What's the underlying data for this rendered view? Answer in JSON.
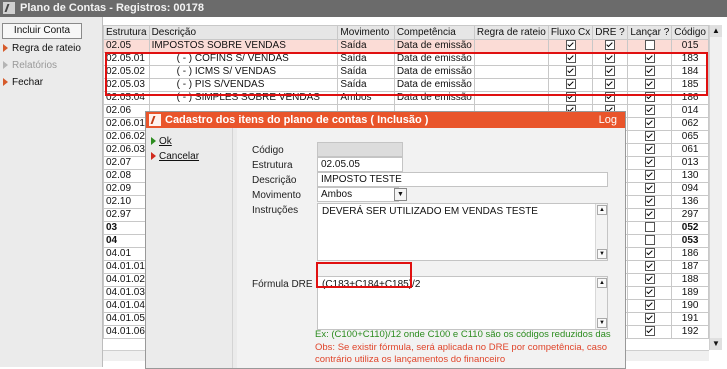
{
  "window": {
    "title": "Plano de Contas - Registros: 00178"
  },
  "sidebar": {
    "include_button": "Incluir Conta",
    "items": [
      {
        "label": "Regra de rateio",
        "enabled": true
      },
      {
        "label": "Relatórios",
        "enabled": false
      },
      {
        "label": "Fechar",
        "enabled": true
      }
    ]
  },
  "grid": {
    "columns": [
      "Estrutura",
      "Descrição",
      "Movimento",
      "Competência",
      "Regra de rateio",
      "Fluxo Cx",
      "DRE ?",
      "Lançar ?",
      "Código"
    ],
    "rows": [
      {
        "estrutura": "02.05",
        "descricao": "IMPOSTOS SOBRE VENDAS",
        "movimento": "Saída",
        "competencia": "Data de emissão",
        "regra": "",
        "fluxo": true,
        "dre": true,
        "lancar": false,
        "codigo": "015",
        "highlight": true,
        "bold": false
      },
      {
        "estrutura": "02.05.01",
        "descricao": "         ( - ) COFINS S/ VENDAS",
        "movimento": "Saída",
        "competencia": "Data de emissão",
        "regra": "",
        "fluxo": true,
        "dre": true,
        "lancar": true,
        "codigo": "183",
        "highlight": false,
        "bold": false
      },
      {
        "estrutura": "02.05.02",
        "descricao": "         ( - ) ICMS S/ VENDAS",
        "movimento": "Saída",
        "competencia": "Data de emissão",
        "regra": "",
        "fluxo": true,
        "dre": true,
        "lancar": true,
        "codigo": "184",
        "highlight": false,
        "bold": false
      },
      {
        "estrutura": "02.05.03",
        "descricao": "         ( - ) PIS S/VENDAS",
        "movimento": "Saída",
        "competencia": "Data de emissão",
        "regra": "",
        "fluxo": true,
        "dre": true,
        "lancar": true,
        "codigo": "185",
        "highlight": false,
        "bold": false
      },
      {
        "estrutura": "02.05.04",
        "descricao": "         ( - ) SIMPLES SOBRE VENDAS",
        "movimento": "Ambos",
        "competencia": "Data de emissão",
        "regra": "",
        "fluxo": true,
        "dre": true,
        "lancar": true,
        "codigo": "186",
        "highlight": false,
        "bold": false
      },
      {
        "estrutura": "02.06",
        "descricao": "",
        "movimento": "",
        "competencia": "",
        "regra": "",
        "fluxo": true,
        "dre": true,
        "lancar": true,
        "codigo": "014",
        "highlight": false,
        "bold": false
      },
      {
        "estrutura": "02.06.01",
        "descricao": "",
        "movimento": "",
        "competencia": "",
        "regra": "",
        "fluxo": true,
        "dre": true,
        "lancar": true,
        "codigo": "062",
        "highlight": false,
        "bold": false
      },
      {
        "estrutura": "02.06.02",
        "descricao": "",
        "movimento": "",
        "competencia": "",
        "regra": "",
        "fluxo": true,
        "dre": true,
        "lancar": true,
        "codigo": "065",
        "highlight": false,
        "bold": false
      },
      {
        "estrutura": "02.06.03",
        "descricao": "",
        "movimento": "",
        "competencia": "",
        "regra": "",
        "fluxo": true,
        "dre": true,
        "lancar": true,
        "codigo": "061",
        "highlight": false,
        "bold": false
      },
      {
        "estrutura": "02.07",
        "descricao": "",
        "movimento": "",
        "competencia": "",
        "regra": "",
        "fluxo": true,
        "dre": true,
        "lancar": true,
        "codigo": "013",
        "highlight": false,
        "bold": false
      },
      {
        "estrutura": "02.08",
        "descricao": "",
        "movimento": "",
        "competencia": "",
        "regra": "",
        "fluxo": true,
        "dre": true,
        "lancar": true,
        "codigo": "130",
        "highlight": false,
        "bold": false
      },
      {
        "estrutura": "02.09",
        "descricao": "",
        "movimento": "",
        "competencia": "",
        "regra": "",
        "fluxo": true,
        "dre": true,
        "lancar": true,
        "codigo": "094",
        "highlight": false,
        "bold": false
      },
      {
        "estrutura": "02.10",
        "descricao": "",
        "movimento": "",
        "competencia": "",
        "regra": "",
        "fluxo": true,
        "dre": true,
        "lancar": true,
        "codigo": "136",
        "highlight": false,
        "bold": false
      },
      {
        "estrutura": "02.97",
        "descricao": "",
        "movimento": "",
        "competencia": "",
        "regra": "",
        "fluxo": true,
        "dre": true,
        "lancar": true,
        "codigo": "297",
        "highlight": false,
        "bold": false
      },
      {
        "estrutura": "03",
        "descricao": "",
        "movimento": "",
        "competencia": "",
        "regra": "",
        "fluxo": true,
        "dre": true,
        "lancar": false,
        "codigo": "052",
        "highlight": false,
        "bold": true
      },
      {
        "estrutura": "04",
        "descricao": "",
        "movimento": "",
        "competencia": "",
        "regra": "",
        "fluxo": true,
        "dre": true,
        "lancar": false,
        "codigo": "053",
        "highlight": false,
        "bold": true
      },
      {
        "estrutura": "04.01",
        "descricao": "",
        "movimento": "",
        "competencia": "",
        "regra": "",
        "fluxo": true,
        "dre": true,
        "lancar": true,
        "codigo": "186",
        "highlight": false,
        "bold": false
      },
      {
        "estrutura": "04.01.01",
        "descricao": "",
        "movimento": "",
        "competencia": "",
        "regra": "",
        "fluxo": true,
        "dre": true,
        "lancar": true,
        "codigo": "187",
        "highlight": false,
        "bold": false
      },
      {
        "estrutura": "04.01.02",
        "descricao": "",
        "movimento": "",
        "competencia": "",
        "regra": "",
        "fluxo": true,
        "dre": true,
        "lancar": true,
        "codigo": "188",
        "highlight": false,
        "bold": false
      },
      {
        "estrutura": "04.01.03",
        "descricao": "",
        "movimento": "",
        "competencia": "",
        "regra": "",
        "fluxo": true,
        "dre": true,
        "lancar": true,
        "codigo": "189",
        "highlight": false,
        "bold": false
      },
      {
        "estrutura": "04.01.04",
        "descricao": "",
        "movimento": "",
        "competencia": "",
        "regra": "",
        "fluxo": true,
        "dre": true,
        "lancar": true,
        "codigo": "190",
        "highlight": false,
        "bold": false
      },
      {
        "estrutura": "04.01.05",
        "descricao": "",
        "movimento": "",
        "competencia": "",
        "regra": "",
        "fluxo": true,
        "dre": true,
        "lancar": true,
        "codigo": "191",
        "highlight": false,
        "bold": false
      },
      {
        "estrutura": "04.01.06",
        "descricao": "",
        "movimento": "",
        "competencia": "",
        "regra": "",
        "fluxo": true,
        "dre": true,
        "lancar": true,
        "codigo": "192",
        "highlight": false,
        "bold": false
      }
    ]
  },
  "dialog": {
    "title": "Cadastro dos itens do plano de contas ( Inclusão )",
    "log_label": "Log",
    "ok_label": "Ok",
    "cancel_label": "Cancelar",
    "fields": {
      "codigo_label": "Código",
      "codigo_value": "",
      "estrutura_label": "Estrutura",
      "estrutura_value": "02.05.05",
      "descricao_label": "Descrição",
      "descricao_value": "IMPOSTO TESTE",
      "movimento_label": "Movimento",
      "movimento_value": "Ambos",
      "instrucoes_label": "Instruções",
      "instrucoes_value": "DEVERÁ SER UTILIZADO EM VENDAS TESTE",
      "formula_label": "Fórmula DRE",
      "formula_value": "(C183+C184+C185)/2"
    },
    "example_text": "Ex:  (C100+C110)/12   onde  C100 e C110 são os códigos  reduzidos das",
    "obs_line1": "Obs: Se existir fórmula, será aplicada no DRE por competência,  caso",
    "obs_line2": "contrário utiliza os lançamentos do financeiro"
  },
  "colors": {
    "accent_red": "#e01010",
    "dialog_title": "#e9552b",
    "highlight_row": "#fbdcd6",
    "example_green": "#2c8c1f",
    "obs_orange": "#e0452b"
  }
}
